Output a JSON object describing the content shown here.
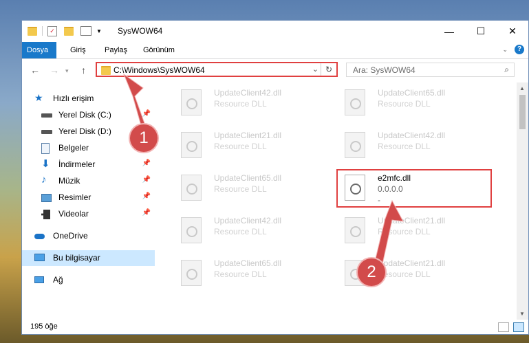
{
  "window": {
    "title": "SysWOW64",
    "controls": {
      "minimize": "—",
      "maximize": "☐",
      "close": "✕"
    }
  },
  "ribbon": {
    "tabs": [
      {
        "label": "Dosya",
        "active": true
      },
      {
        "label": "Giriş",
        "active": false
      },
      {
        "label": "Paylaş",
        "active": false
      },
      {
        "label": "Görünüm",
        "active": false
      }
    ],
    "help": "?"
  },
  "navbar": {
    "back": "←",
    "forward": "→",
    "up": "↑",
    "address": "C:\\Windows\\SysWOW64",
    "search_placeholder": "Ara: SysWOW64"
  },
  "sidebar": {
    "items": [
      {
        "label": "Hızlı erişim",
        "icon": "star-icon",
        "pinned": false
      },
      {
        "label": "Yerel Disk (C:)",
        "icon": "drive-icon",
        "pinned": true
      },
      {
        "label": "Yerel Disk (D:)",
        "icon": "drive-icon",
        "pinned": false
      },
      {
        "label": "Belgeler",
        "icon": "documents-icon",
        "pinned": true
      },
      {
        "label": "İndirmeler",
        "icon": "download-icon",
        "pinned": true
      },
      {
        "label": "Müzik",
        "icon": "music-icon",
        "pinned": true
      },
      {
        "label": "Resimler",
        "icon": "pictures-icon",
        "pinned": true
      },
      {
        "label": "Videolar",
        "icon": "videos-icon",
        "pinned": true
      },
      {
        "label": "OneDrive",
        "icon": "cloud-icon",
        "pinned": false
      },
      {
        "label": "Bu bilgisayar",
        "icon": "computer-icon",
        "pinned": false,
        "selected": true
      },
      {
        "label": "Ağ",
        "icon": "network-icon",
        "pinned": false
      }
    ]
  },
  "files": [
    {
      "name": "UpdateClient42.dll",
      "type": "Resource DLL"
    },
    {
      "name": "UpdateClient65.dll",
      "type": "Resource DLL"
    },
    {
      "name": "UpdateClient21.dll",
      "type": "Resource DLL"
    },
    {
      "name": "UpdateClient42.dll",
      "type": "Resource DLL"
    },
    {
      "name": "UpdateClient65.dll",
      "type": "Resource DLL"
    },
    {
      "name": "e2mfc.dll",
      "type": "0.0.0.0",
      "extra": "-"
    },
    {
      "name": "UpdateClient42.dll",
      "type": "Resource DLL"
    },
    {
      "name": "UpdateClient21.dll",
      "type": "Resource DLL"
    },
    {
      "name": "UpdateClient65.dll",
      "type": "Resource DLL"
    },
    {
      "name": "UpdateClient21.dll",
      "type": "Resource DLL"
    }
  ],
  "status": {
    "count": "195 öğe"
  },
  "annotations": {
    "badge1": "1",
    "badge2": "2",
    "color": "#d24b4b"
  }
}
